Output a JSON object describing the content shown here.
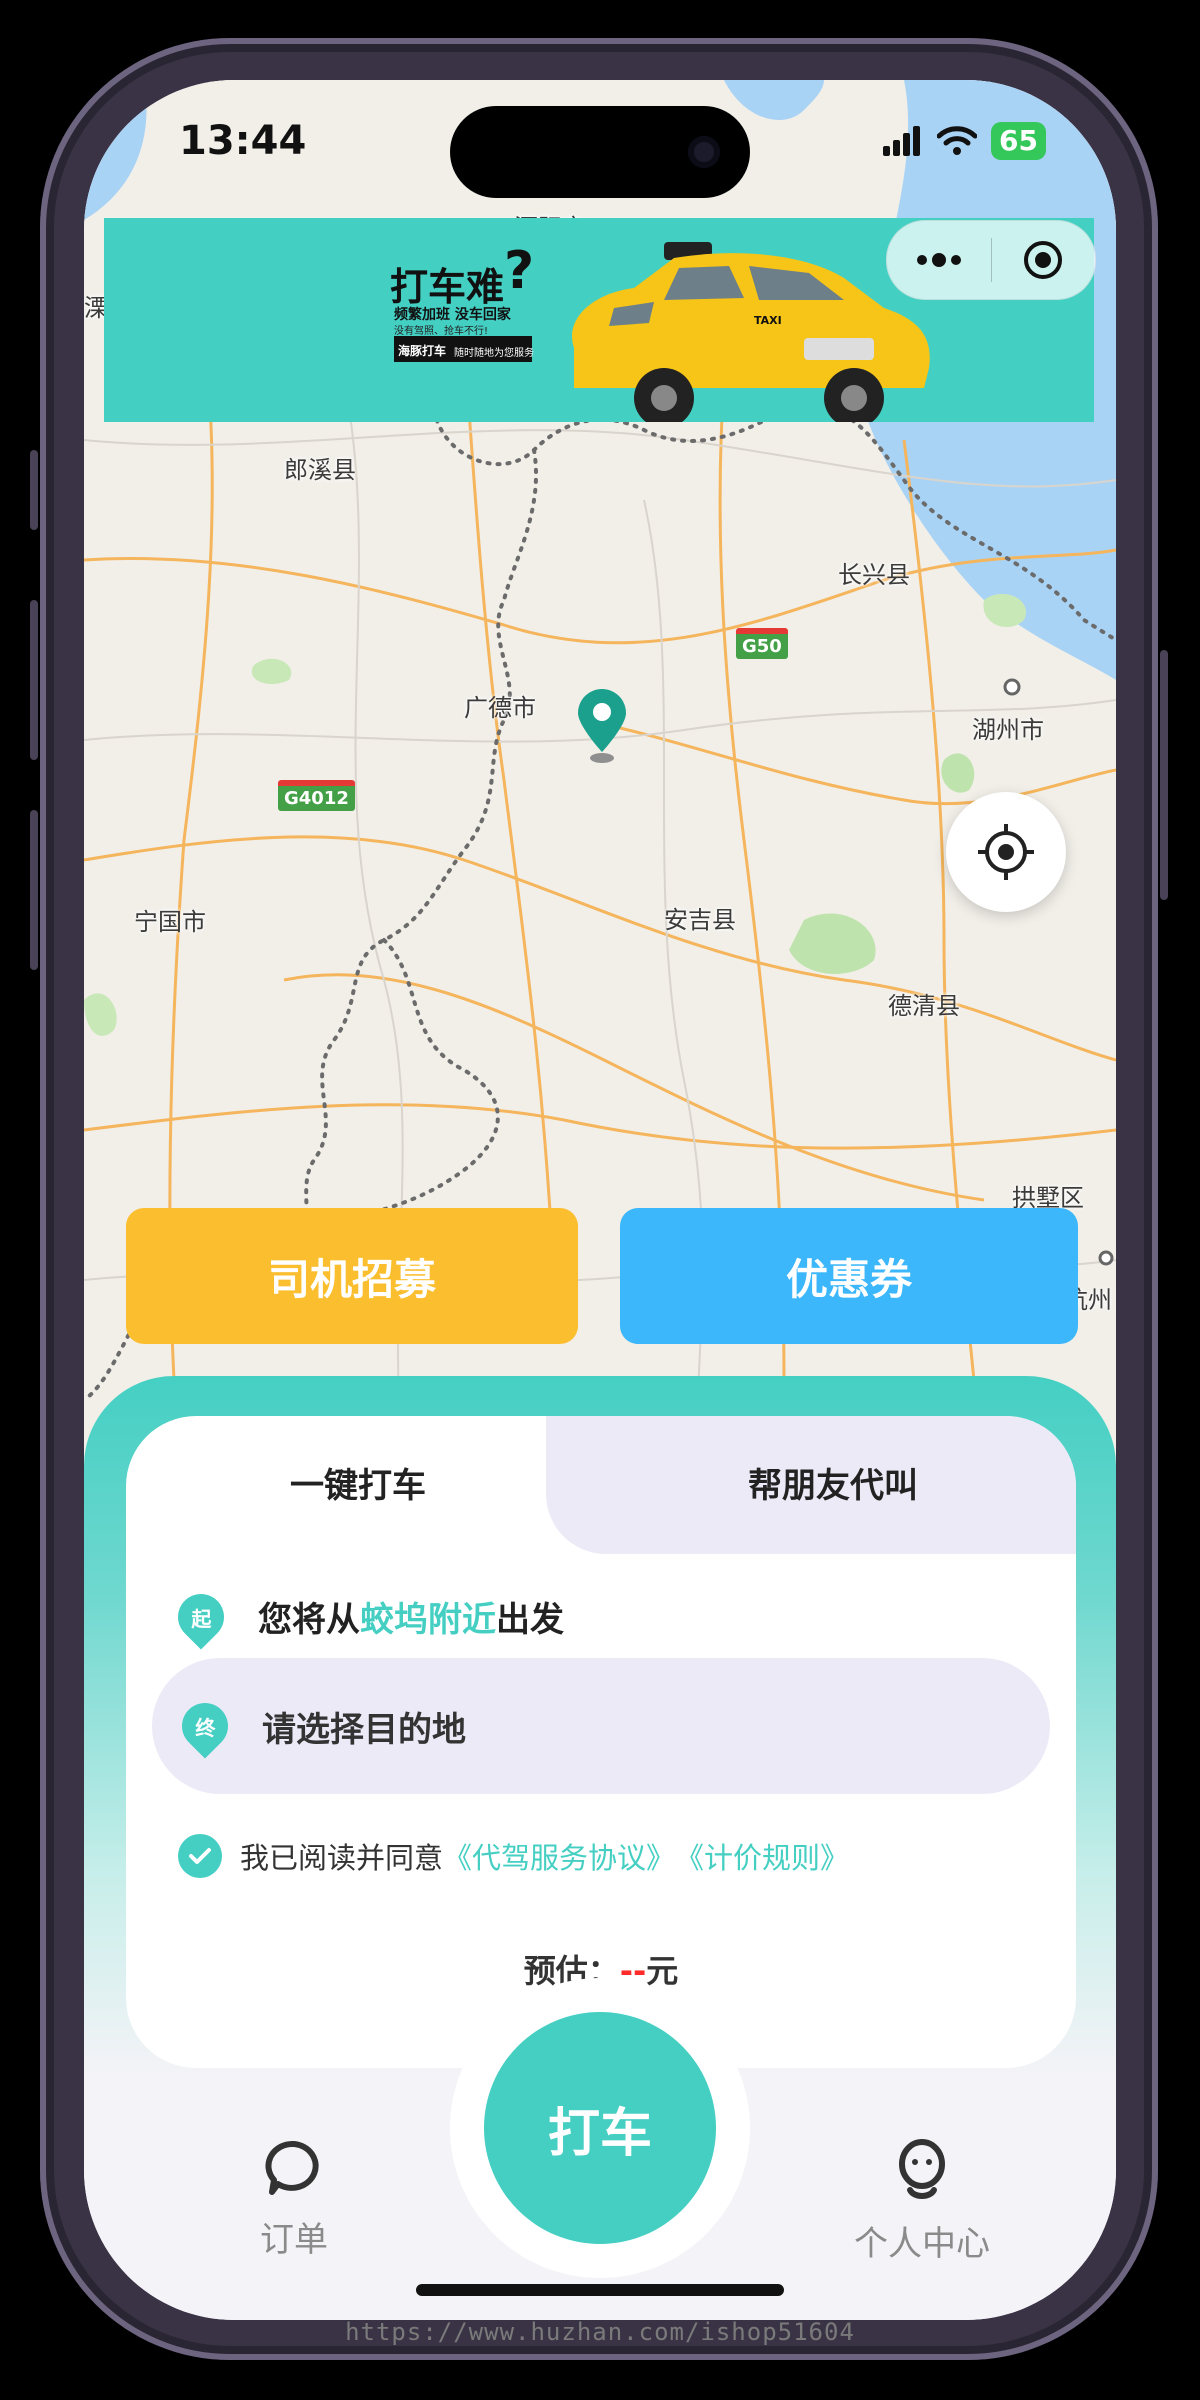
{
  "status_bar": {
    "time": "13:44",
    "battery": "65"
  },
  "banner": {
    "title": "打车难",
    "subtitle": "频繁加班 没车回家",
    "tagline": "没有驾照、抢车不行!",
    "brand": "海豚打车",
    "brand_tagline": "随时随地为您服务",
    "taxi_text": "TAXI"
  },
  "map": {
    "labels": [
      "溧阳市",
      "溧",
      "郎溪县",
      "长兴县",
      "广德市",
      "湖州市",
      "宁国市",
      "安吉县",
      "德清县",
      "拱墅区",
      "杭州"
    ],
    "road_badges": [
      "G50",
      "G4012"
    ]
  },
  "actions": {
    "driver_recruit": "司机招募",
    "coupon": "优惠券"
  },
  "booking": {
    "tabs": [
      "一键打车",
      "帮朋友代叫"
    ],
    "from_prefix": "您将从",
    "from_place": "蛟坞附近",
    "from_suffix": "出发",
    "from_pin": "起",
    "dest_pin": "终",
    "dest_placeholder": "请选择目的地",
    "agree_text": "我已阅读并同意",
    "agree_link1": "《代驾服务协议》",
    "agree_link2": "《计价规则》",
    "estimate_label": "预估：",
    "estimate_value": "--",
    "estimate_unit": "元"
  },
  "nav": {
    "orders": "订单",
    "call": "打车",
    "profile": "个人中心"
  },
  "watermark": "https://www.huzhan.com/ishop51604",
  "colors": {
    "accent": "#45cfc3",
    "driver_btn": "#fbbe2f",
    "coupon_btn": "#3cb7fb",
    "estimate_dash": "#ff2a2a"
  }
}
